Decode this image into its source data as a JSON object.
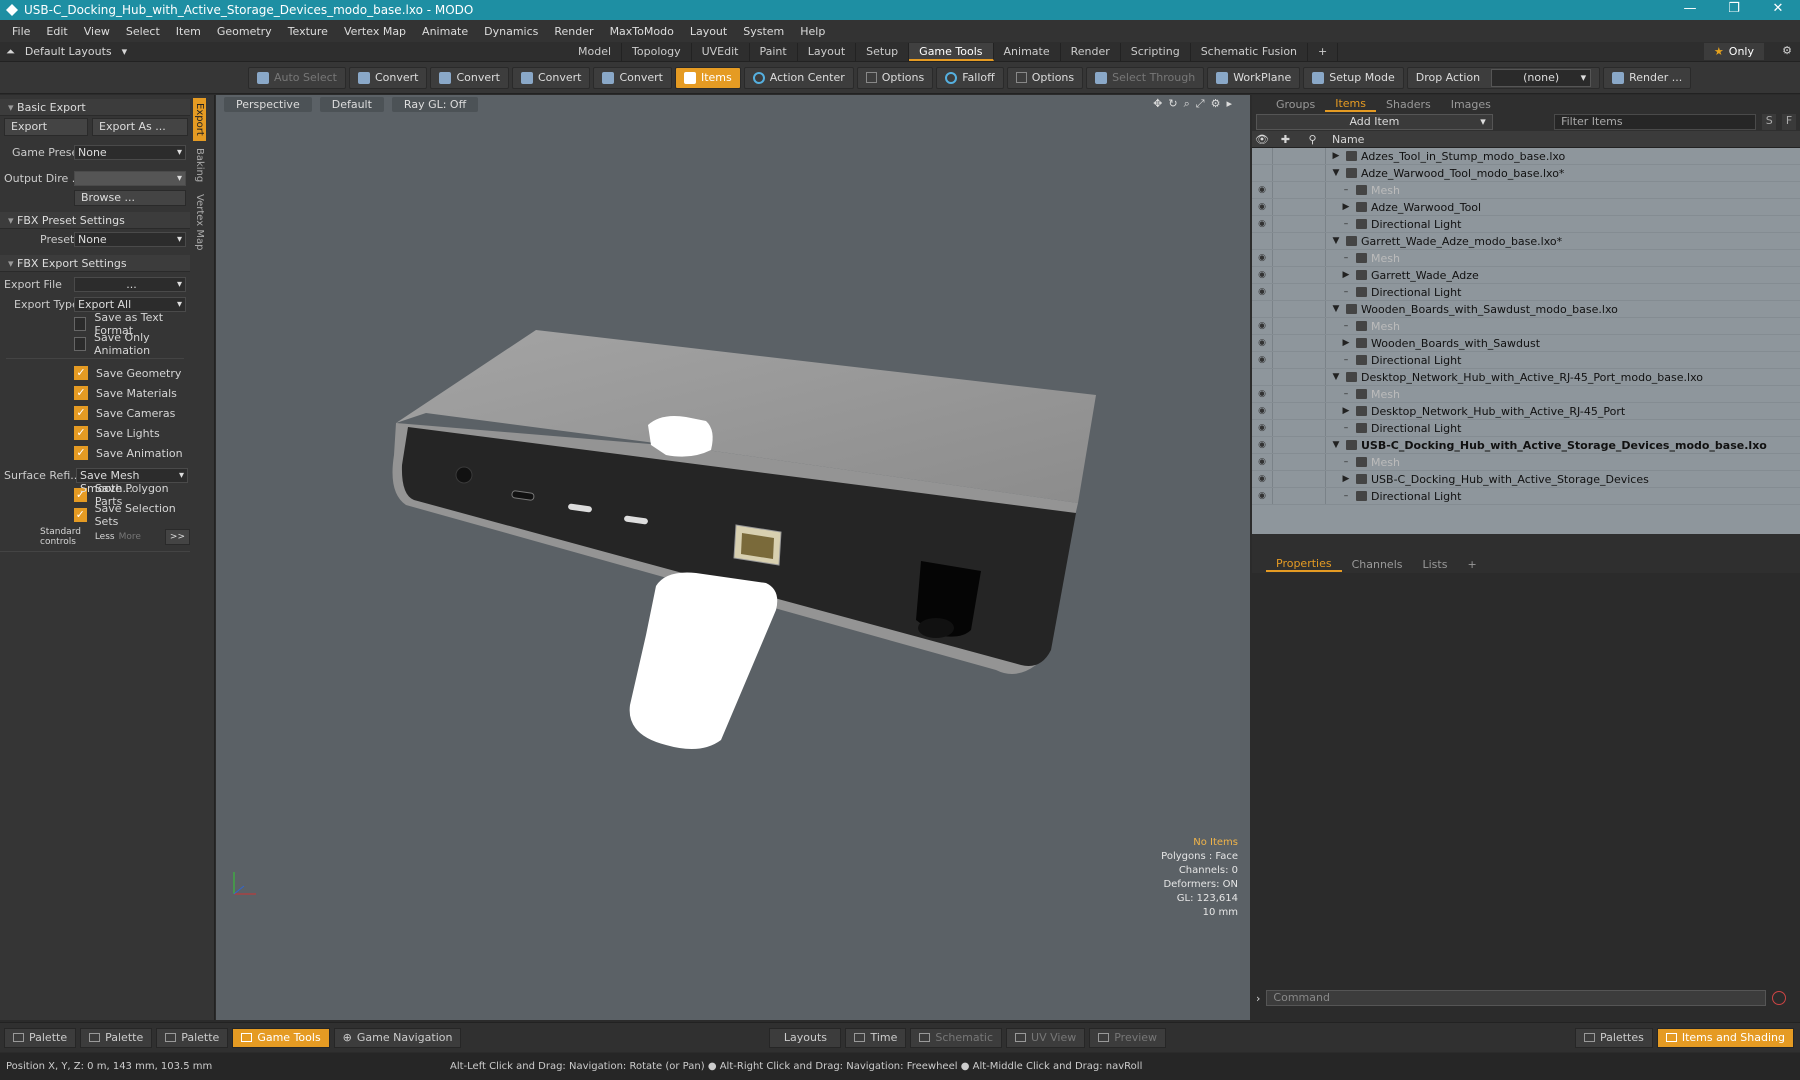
{
  "window": {
    "title": "USB-C_Docking_Hub_with_Active_Storage_Devices_modo_base.lxo - MODO"
  },
  "menu": [
    "File",
    "Edit",
    "View",
    "Select",
    "Item",
    "Geometry",
    "Texture",
    "Vertex Map",
    "Animate",
    "Dynamics",
    "Render",
    "MaxToModo",
    "Layout",
    "System",
    "Help"
  ],
  "layouts": {
    "default_label": "Default Layouts",
    "only_label": "Only",
    "tabs": [
      "Model",
      "Topology",
      "UVEdit",
      "Paint",
      "Layout",
      "Setup",
      "Game Tools",
      "Animate",
      "Render",
      "Scripting",
      "Schematic Fusion",
      "+"
    ],
    "active_tab": "Game Tools"
  },
  "toolbar": {
    "auto_select": "Auto Select",
    "convert1": "Convert",
    "convert2": "Convert",
    "convert3": "Convert",
    "convert4": "Convert",
    "items": "Items",
    "action_center": "Action Center",
    "options1": "Options",
    "falloff": "Falloff",
    "options2": "Options",
    "select_through": "Select Through",
    "workplane": "WorkPlane",
    "setup_mode": "Setup Mode",
    "drop_action": "Drop Action",
    "drop_value": "(none)",
    "render": "Render ..."
  },
  "left": {
    "side_tabs": [
      "Export",
      "Baking",
      "Vertex Map"
    ],
    "basic_export": "Basic Export",
    "export_btn": "Export",
    "export_as_btn": "Export As ...",
    "game_preset_label": "Game Preset",
    "game_preset_value": "None",
    "output_dir_label": "Output Dire ...",
    "browse": "Browse ...",
    "fbx_preset": "FBX Preset Settings",
    "preset_label": "Preset",
    "preset_value": "None",
    "fbx_export": "FBX Export Settings",
    "export_file_label": "Export File",
    "export_file_value": "...",
    "export_type_label": "Export Type",
    "export_type_value": "Export All",
    "save_text": "Save as Text Format",
    "save_anim_only": "Save Only Animation",
    "save_geometry": "Save Geometry",
    "save_materials": "Save Materials",
    "save_cameras": "Save Cameras",
    "save_lights": "Save Lights",
    "save_animation": "Save Animation",
    "surface_label": "Surface Refi...",
    "surface_value": "Save Mesh Smooth...",
    "save_poly": "Save Polygon Parts",
    "save_sel": "Save Selection Sets",
    "std_controls": "Standard controls",
    "less": "Less",
    "more": "More",
    "expand": ">>"
  },
  "viewport": {
    "perspective": "Perspective",
    "default": "Default",
    "raygl": "Ray GL: Off",
    "stats": {
      "items": "No Items",
      "polygons": "Polygons : Face",
      "channels": "Channels: 0",
      "deformers": "Deformers: ON",
      "gl": "GL: 123,614",
      "scale": "10 mm"
    }
  },
  "right": {
    "tabs": [
      "Groups",
      "Items",
      "Shaders",
      "Images"
    ],
    "active_tab": "Items",
    "add_item": "Add Item",
    "filter": "Filter Items",
    "s": "S",
    "f": "F",
    "name_col": "Name",
    "tree": [
      {
        "label": "Adzes_Tool_in_Stump_modo_base.lxo",
        "level": 0,
        "arrow": "▶",
        "eye": false
      },
      {
        "label": "Adze_Warwood_Tool_modo_base.lxo*",
        "level": 0,
        "arrow": "▼",
        "eye": false
      },
      {
        "label": "Mesh",
        "level": 1,
        "arrow": "",
        "eye": true,
        "dim": true
      },
      {
        "label": "Adze_Warwood_Tool",
        "level": 1,
        "arrow": "▶",
        "eye": true
      },
      {
        "label": "Directional Light",
        "level": 1,
        "arrow": "",
        "eye": true
      },
      {
        "label": "Garrett_Wade_Adze_modo_base.lxo*",
        "level": 0,
        "arrow": "▼",
        "eye": false
      },
      {
        "label": "Mesh",
        "level": 1,
        "arrow": "",
        "eye": true,
        "dim": true
      },
      {
        "label": "Garrett_Wade_Adze",
        "level": 1,
        "arrow": "▶",
        "eye": true
      },
      {
        "label": "Directional Light",
        "level": 1,
        "arrow": "",
        "eye": true
      },
      {
        "label": "Wooden_Boards_with_Sawdust_modo_base.lxo",
        "level": 0,
        "arrow": "▼",
        "eye": false
      },
      {
        "label": "Mesh",
        "level": 1,
        "arrow": "",
        "eye": true,
        "dim": true
      },
      {
        "label": "Wooden_Boards_with_Sawdust",
        "level": 1,
        "arrow": "▶",
        "eye": true
      },
      {
        "label": "Directional Light",
        "level": 1,
        "arrow": "",
        "eye": true
      },
      {
        "label": "Desktop_Network_Hub_with_Active_RJ-45_Port_modo_base.lxo",
        "level": 0,
        "arrow": "▼",
        "eye": false
      },
      {
        "label": "Mesh",
        "level": 1,
        "arrow": "",
        "eye": true,
        "dim": true
      },
      {
        "label": "Desktop_Network_Hub_with_Active_RJ-45_Port",
        "level": 1,
        "arrow": "▶",
        "eye": true
      },
      {
        "label": "Directional Light",
        "level": 1,
        "arrow": "",
        "eye": true
      },
      {
        "label": "USB-C_Docking_Hub_with_Active_Storage_Devices_modo_base.lxo",
        "level": 0,
        "arrow": "▼",
        "eye": true,
        "bold": true
      },
      {
        "label": "Mesh",
        "level": 1,
        "arrow": "",
        "eye": true,
        "dim": true
      },
      {
        "label": "USB-C_Docking_Hub_with_Active_Storage_Devices",
        "level": 1,
        "arrow": "▶",
        "eye": true
      },
      {
        "label": "Directional Light",
        "level": 1,
        "arrow": "",
        "eye": true
      }
    ],
    "props_tabs": [
      "Properties",
      "Channels",
      "Lists",
      "+"
    ],
    "props_active": "Properties",
    "command_placeholder": "Command"
  },
  "bottom": {
    "palette1": "Palette",
    "palette2": "Palette",
    "palette3": "Palette",
    "game_tools": "Game Tools",
    "game_nav": "Game Navigation",
    "layouts": "Layouts",
    "time": "Time",
    "schematic": "Schematic",
    "uv_view": "UV View",
    "preview": "Preview",
    "palettes": "Palettes",
    "items_shading": "Items and Shading"
  },
  "status": {
    "position": "Position X, Y, Z:   0 m, 143 mm, 103.5 mm",
    "hint": "Alt-Left Click and Drag: Navigation: Rotate (or Pan) ● Alt-Right Click and Drag: Navigation: Freewheel ● Alt-Middle Click and Drag: navRoll"
  },
  "colors": {
    "accent": "#e59b23",
    "titlebar": "#1e8fa3",
    "viewport": "#5b6166"
  }
}
